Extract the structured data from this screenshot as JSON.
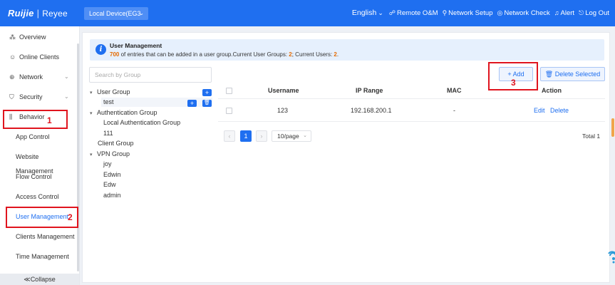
{
  "header": {
    "logo": "Ruijie",
    "logo_sub": "Reyee",
    "device": "Local Device(EG3",
    "language": "English",
    "nav": [
      {
        "icon": "remote-om-icon",
        "glyph": "☍",
        "label": "Remote O&M"
      },
      {
        "icon": "network-setup-icon",
        "glyph": "⚲",
        "label": "Network Setup"
      },
      {
        "icon": "network-check-icon",
        "glyph": "◎",
        "label": "Network Check"
      },
      {
        "icon": "alert-icon",
        "glyph": "♫",
        "label": "Alert"
      },
      {
        "icon": "logout-icon",
        "glyph": "⎋",
        "label": "Log Out"
      }
    ]
  },
  "sidebar": {
    "items": [
      {
        "label": "Overview",
        "icon": "overview-icon",
        "glyph": "⁂"
      },
      {
        "label": "Online Clients",
        "icon": "online-clients-icon",
        "glyph": "☺"
      },
      {
        "label": "Network",
        "icon": "network-icon",
        "glyph": "⊕",
        "arrow": "⌄"
      },
      {
        "label": "Security",
        "icon": "security-icon",
        "glyph": "⛉",
        "arrow": "⌄"
      },
      {
        "label": "Behavior",
        "icon": "behavior-icon",
        "glyph": "⫼"
      }
    ],
    "behavior_sub": [
      "App Control",
      "Website Management",
      "Flow Control",
      "Access Control",
      "User Management",
      "Clients Management",
      "Time Management"
    ],
    "collapse": "≪Collapse"
  },
  "info": {
    "title": "User Management",
    "count": "700",
    "text_mid": " of entries that can be added in a user group.Current User Groups: ",
    "groups": "2",
    "text_users": "; Current Users: ",
    "users": "2",
    "text_end": "."
  },
  "search": {
    "placeholder": "Search by Group"
  },
  "tree": {
    "user_group": "User Group",
    "test": "test",
    "auth_group": "Authentication Group",
    "local_auth_group": "Local Authentication Group",
    "g111": "111",
    "client_group": "Client Group",
    "vpn_group": "VPN Group",
    "vpn_users": [
      "joy",
      "Edwin",
      "Edw",
      "admin"
    ],
    "add_glyph": "+",
    "delete_glyph": "🗑"
  },
  "toolbar": {
    "add": "+ Add",
    "delete_selected": "🗑 Delete Selected"
  },
  "table": {
    "headers": {
      "username": "Username",
      "ip_range": "IP Range",
      "mac": "MAC",
      "action": "Action"
    },
    "rows": [
      {
        "username": "123",
        "ip_range": "192.168.200.1",
        "mac": "-",
        "edit": "Edit",
        "delete": "Delete"
      }
    ]
  },
  "pagination": {
    "prev": "‹",
    "current": "1",
    "next": "›",
    "page_size": "10/page",
    "total": "Total 1"
  },
  "annotations": [
    "1",
    "2",
    "3"
  ],
  "colors": {
    "primary": "#1f6ff0",
    "annotation": "#e0141e",
    "count_highlight": "#e56a00"
  }
}
